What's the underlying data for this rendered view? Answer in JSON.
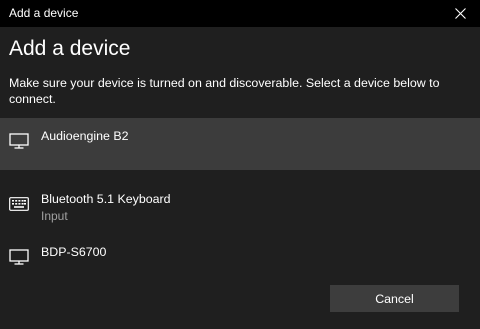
{
  "window": {
    "title": "Add a device"
  },
  "heading": "Add a device",
  "instructions": "Make sure your device is turned on and discoverable. Select a device below to connect.",
  "devices": [
    {
      "name": "Audioengine B2",
      "type": "",
      "icon": "monitor-icon",
      "selected": true
    },
    {
      "name": "Bluetooth 5.1 Keyboard",
      "type": "Input",
      "icon": "keyboard-icon",
      "selected": false
    },
    {
      "name": "BDP-S6700",
      "type": "",
      "icon": "monitor-icon",
      "selected": false
    }
  ],
  "buttons": {
    "cancel": "Cancel"
  },
  "colors": {
    "titlebar": "#000000",
    "background": "#1f1f1f",
    "selected_row": "#3c3c3c",
    "button": "#3d3d3d",
    "secondary_text": "#a0a0a0"
  }
}
